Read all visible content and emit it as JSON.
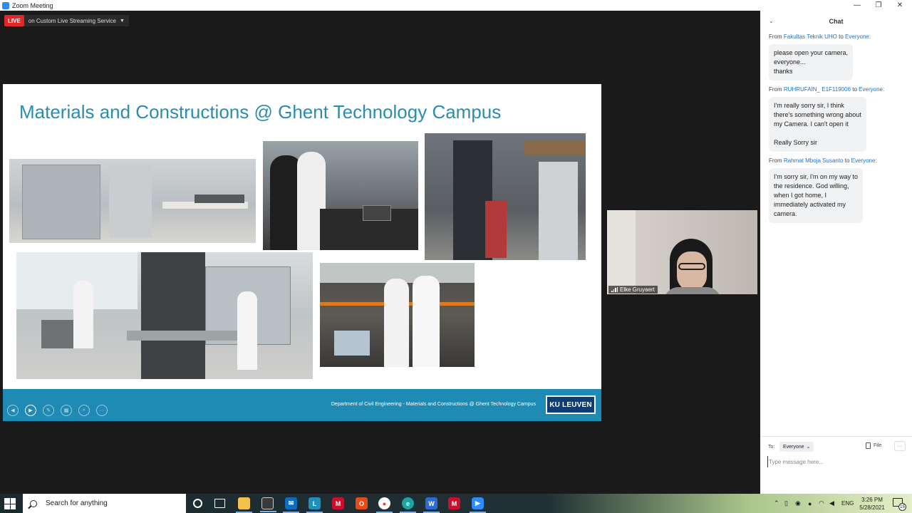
{
  "window": {
    "title": "Zoom Meeting",
    "minimize_icon": "—",
    "maximize_icon": "❐",
    "close_icon": "✕"
  },
  "live": {
    "badge": "LIVE",
    "service": "on Custom Live Streaming Service"
  },
  "slide": {
    "title": "Materials and Constructions @ Ghent Technology Campus",
    "footer_text": "Department of Civil Engineering - Materials and Constructions @ Ghent Technology Campus",
    "logo_text": "KU LEUVEN"
  },
  "video": {
    "participant_name": "Elke Gruyaert"
  },
  "chat": {
    "title": "Chat",
    "messages": [
      {
        "from_prefix": "From",
        "sender": "Fakultas Teknik UHO",
        "to_word": "to",
        "recipient": "Everyone:",
        "text": "please open your camera,\neveryone...\nthanks"
      },
      {
        "from_prefix": "From",
        "sender": "RUHRUFAIN_ E1F119006",
        "to_word": "to",
        "recipient": "Everyone:",
        "text": "I'm really sorry sir, I think\nthere's something wrong about\nmy Camera. I can't open it\n\nReally Sorry sir"
      },
      {
        "from_prefix": "From",
        "sender": "Rahmat Mboja Susanto",
        "to_word": "to",
        "recipient": "Everyone:",
        "text": "I'm sorry sir, I'm on my way to\nthe residence. God willing,\nwhen I got home, I\nimmediately activated my\ncamera."
      }
    ],
    "to_label": "To:",
    "to_value": "Everyone",
    "file_label": "File",
    "more_label": "···",
    "input_placeholder": "Type message here..."
  },
  "taskbar": {
    "search_text": "Search for anything",
    "language": "ENG",
    "time": "3:26 PM",
    "date": "5/28/2021",
    "notification_count": "15"
  },
  "colors": {
    "slide_title": "#2a8db0",
    "slide_footer": "#1f8bb5",
    "live_red": "#e02828",
    "chat_link": "#1a73c7"
  }
}
